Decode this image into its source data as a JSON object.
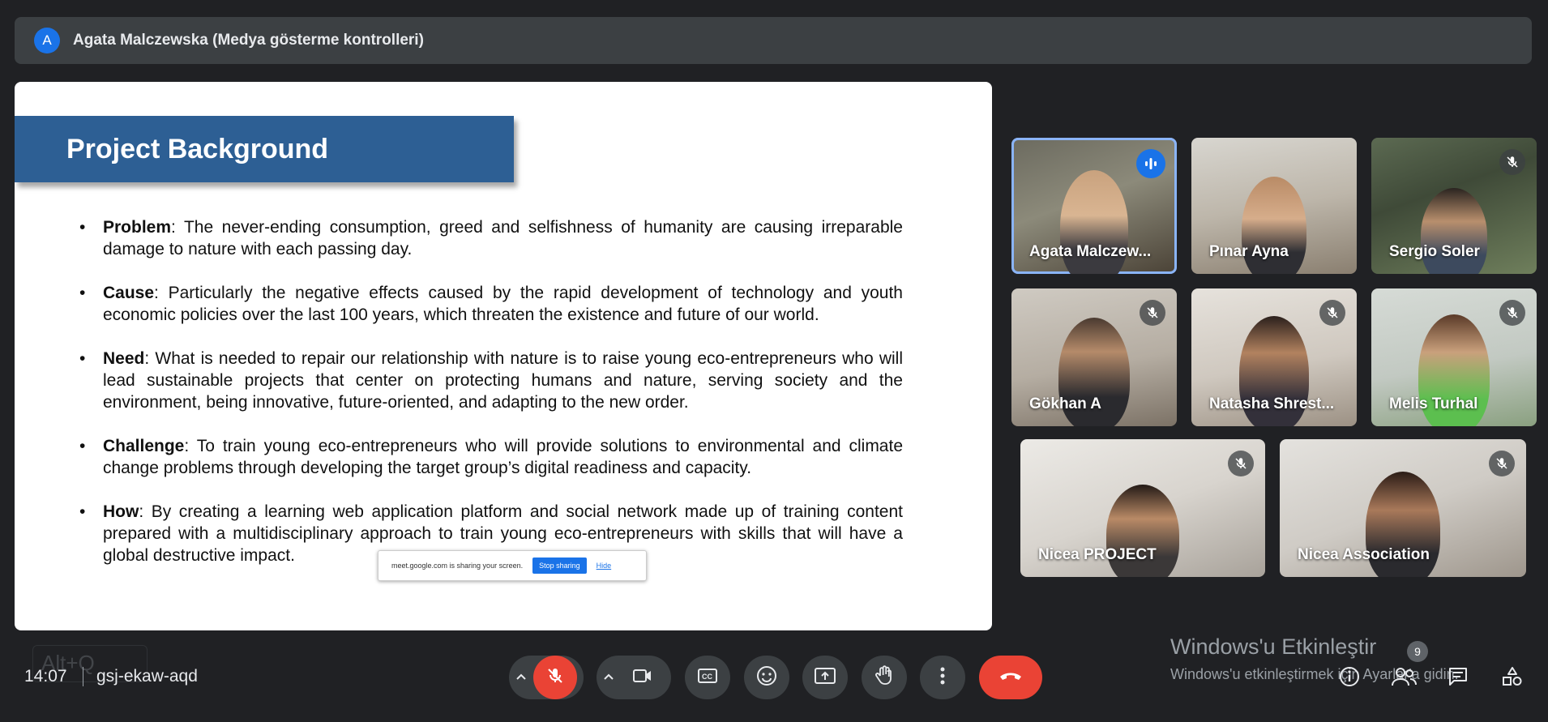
{
  "presenter": {
    "avatar_letter": "A",
    "label": "Agata Malczewska (Medya gösterme kontrolleri)"
  },
  "slide": {
    "title": "Project Background",
    "bullets": [
      {
        "term": "Problem",
        "text": ": The never-ending consumption, greed and selfishness of humanity are causing irreparable damage to nature with each passing day."
      },
      {
        "term": "Cause",
        "text": ": Particularly the negative effects caused by the rapid development of technology and youth economic policies over the last 100 years, which threaten the existence and future of our world."
      },
      {
        "term": "Need",
        "text": ": What is needed to repair our relationship with nature is to raise young eco-entrepreneurs who will lead sustainable projects that center on protecting humans and nature, serving society and the environment, being innovative, future-oriented, and adapting to the new order."
      },
      {
        "term": "Challenge",
        "text": ": To train young eco-entrepreneurs who will provide solutions to environmental and climate change problems through developing the target group’s digital readiness and capacity."
      },
      {
        "term": "How",
        "text": ": By creating a learning web application platform and social network made up of training content prepared with a multidisciplinary approach to train young eco-entrepreneurs with skills that will have a global destructive impact."
      }
    ],
    "share_popup": {
      "message": "meet.google.com is sharing your screen.",
      "stop_label": "Stop sharing",
      "hide_label": "Hide"
    }
  },
  "participants": [
    {
      "name": "Agata Malczew...",
      "state": "speaking"
    },
    {
      "name": "Pınar Ayna",
      "state": "unmuted"
    },
    {
      "name": "Sergio Soler",
      "state": "muted"
    },
    {
      "name": "Gökhan A",
      "state": "muted"
    },
    {
      "name": "Natasha Shrest...",
      "state": "muted"
    },
    {
      "name": "Melis Turhal",
      "state": "muted"
    },
    {
      "name": "Nicea PROJECT",
      "state": "muted"
    },
    {
      "name": "Nicea Association",
      "state": "muted"
    }
  ],
  "bottom_bar": {
    "time": "14:07",
    "meeting_code": "gsj-ekaw-aqd",
    "alt_hint": "Alt+Q"
  },
  "controls": {
    "mic": "mic-off-icon",
    "camera": "camera-icon",
    "captions": "captions-icon",
    "emoji": "emoji-icon",
    "present": "present-icon",
    "raise_hand": "raise-hand-icon",
    "more": "more-options-icon",
    "hangup": "hangup-icon"
  },
  "watermark": {
    "title": "Windows'u Etkinleştir",
    "subtitle": "Windows'u etkinleştirmek için Ayarlar'a gidin."
  },
  "people_count": "9",
  "colors": {
    "background": "#202124",
    "bar": "#3c4043",
    "slide_title_bg": "#2d5f94",
    "danger": "#ea4335",
    "accent": "#1a73e8",
    "active_outline": "#8ab4f8"
  }
}
